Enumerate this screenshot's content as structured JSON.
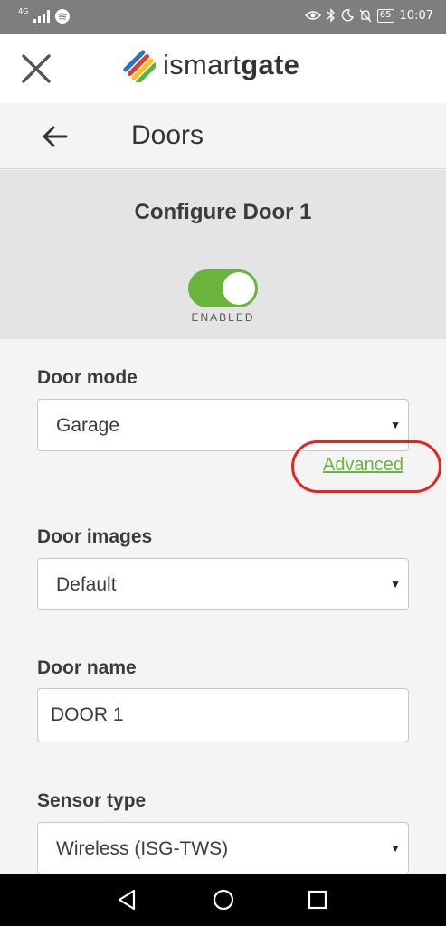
{
  "status_bar": {
    "network_label": "4G",
    "battery": "65",
    "time": "10:07"
  },
  "header": {
    "brand_light": "ismart",
    "brand_bold": "gate"
  },
  "nav": {
    "title": "Doors"
  },
  "config": {
    "title": "Configure Door 1",
    "toggle_label": "ENABLED",
    "enabled": true
  },
  "fields": {
    "door_mode": {
      "label": "Door mode",
      "value": "Garage"
    },
    "advanced_link": "Advanced",
    "door_images": {
      "label": "Door images",
      "value": "Default"
    },
    "door_name": {
      "label": "Door name",
      "value": "DOOR 1"
    },
    "sensor_type": {
      "label": "Sensor type",
      "value": "Wireless (ISG-TWS)"
    }
  },
  "icons": {
    "close": "close-icon",
    "back": "arrow-left-icon",
    "caret": "caret-down-icon"
  },
  "colors": {
    "accent_green": "#6ab43e",
    "highlight_red": "#e4231f",
    "status_bar": "#7e7e7e"
  }
}
